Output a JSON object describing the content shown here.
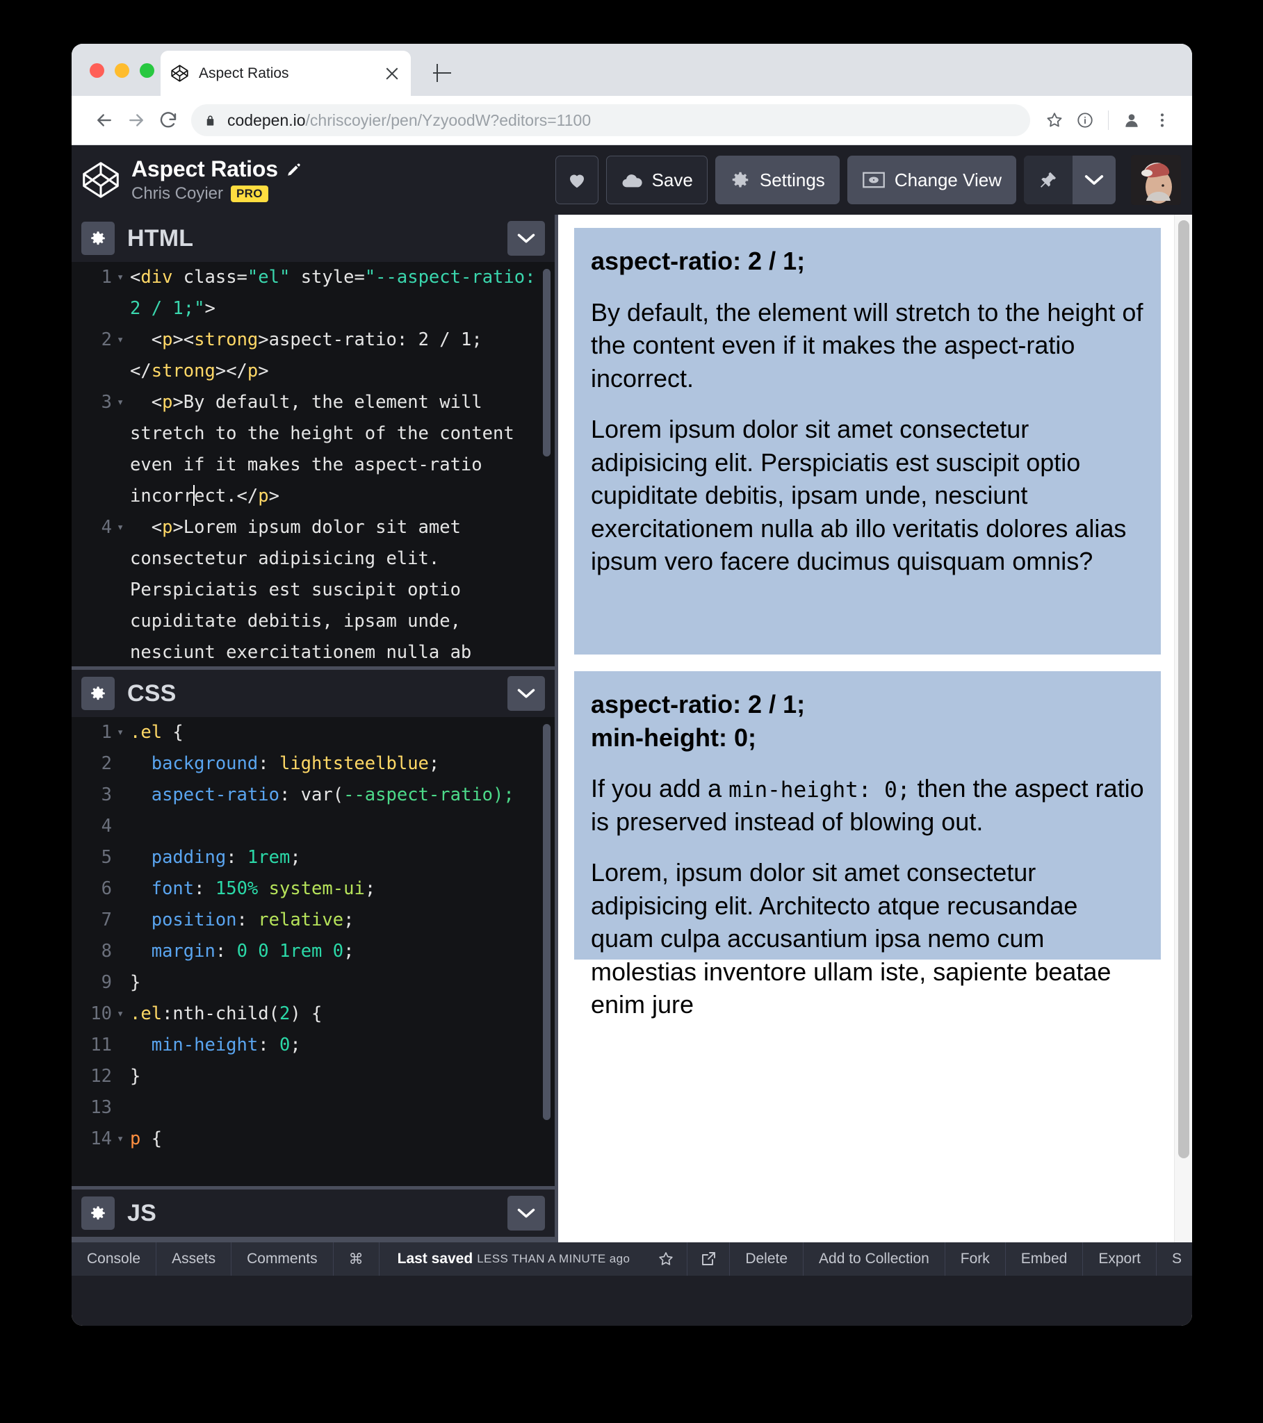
{
  "browser": {
    "tab": {
      "title": "Aspect Ratios",
      "favicon": "codepen-logo-icon",
      "close": "close-icon"
    },
    "new_tab": "new-tab-icon",
    "nav": {
      "back": "back-arrow-icon",
      "forward": "forward-arrow-icon",
      "reload": "reload-icon"
    },
    "omnibox": {
      "lock": "lock-icon",
      "host": "codepen.io",
      "path": "/chriscoyier/pen/YzyoodW?editors=1100",
      "full_url": "codepen.io/chriscoyier/pen/YzyoodW?editors=1100",
      "bookmark": "star-icon",
      "info": "info-circle-icon",
      "profile": "profile-avatar-icon",
      "menu": "three-dot-menu-icon"
    }
  },
  "pen_header": {
    "logo": "codepen-logo-icon",
    "title": "Aspect Ratios",
    "edit_icon": "pencil-icon",
    "author": "Chris Coyier",
    "pro_badge": "PRO",
    "buttons": {
      "heart": {
        "label": "",
        "icon": "heart-icon"
      },
      "save": {
        "label": "Save",
        "icon": "cloud-icon"
      },
      "settings": {
        "label": "Settings",
        "icon": "gear-icon"
      },
      "change_view": {
        "label": "Change View",
        "icon": "screen-eye-icon"
      },
      "pin": {
        "icon": "pin-icon"
      },
      "pin_caret": {
        "icon": "chevron-down-icon"
      }
    },
    "avatar": "user-avatar"
  },
  "editors": [
    {
      "id": "html",
      "label": "HTML",
      "gear": "gear-icon",
      "caret": "chevron-down-icon"
    },
    {
      "id": "css",
      "label": "CSS",
      "gear": "gear-icon",
      "caret": "chevron-down-icon"
    },
    {
      "id": "js",
      "label": "JS",
      "gear": "gear-icon",
      "caret": "chevron-down-icon"
    }
  ],
  "html_code": {
    "lines": [
      {
        "n": "1",
        "fold": true
      },
      {
        "n": "2",
        "fold": true
      },
      {
        "n": "3",
        "fold": true
      },
      {
        "n": "4",
        "fold": true
      }
    ],
    "source": [
      "<div class=\"el\" style=\"--aspect-ratio: 2 / 1;\">",
      "  <p><strong>aspect-ratio: 2 / 1;</strong></p>",
      "  <p>By default, the element will stretch to the height of the content even if it makes the aspect-ratio incorrect.</p>",
      "  <p>Lorem ipsum dolor sit amet consectetur adipisicing elit. Perspiciatis est suscipit optio cupiditate debitis, ipsam unde, nesciunt exercitationem nulla ab"
    ]
  },
  "css_code": {
    "lines": [
      {
        "n": "1",
        "fold": true,
        "text": ".el {"
      },
      {
        "n": "2",
        "fold": false,
        "text": "  background: lightsteelblue;"
      },
      {
        "n": "3",
        "fold": false,
        "text": "  aspect-ratio: var(--aspect-ratio);"
      },
      {
        "n": "4",
        "fold": false,
        "text": ""
      },
      {
        "n": "5",
        "fold": false,
        "text": "  padding: 1rem;"
      },
      {
        "n": "6",
        "fold": false,
        "text": "  font: 150% system-ui;"
      },
      {
        "n": "7",
        "fold": false,
        "text": "  position: relative;"
      },
      {
        "n": "8",
        "fold": false,
        "text": "  margin: 0 0 1rem 0;"
      },
      {
        "n": "9",
        "fold": false,
        "text": "}"
      },
      {
        "n": "10",
        "fold": true,
        "text": ".el:nth-child(2) {"
      },
      {
        "n": "11",
        "fold": false,
        "text": "  min-height: 0;"
      },
      {
        "n": "12",
        "fold": false,
        "text": "}"
      },
      {
        "n": "13",
        "fold": false,
        "text": ""
      },
      {
        "n": "14",
        "fold": true,
        "text": "p {"
      }
    ]
  },
  "preview": {
    "block1": {
      "heading": "aspect-ratio: 2 / 1;",
      "p1": "By default, the element will stretch to the height of the content even if it makes the aspect-ratio incorrect.",
      "p2": "Lorem ipsum dolor sit amet consectetur adipisicing elit. Perspiciatis est suscipit optio cupiditate debitis, ipsam unde, nesciunt exercitationem nulla ab illo veritatis dolores alias ipsum vero facere ducimus quisquam omnis?"
    },
    "block2": {
      "heading_line1": "aspect-ratio: 2 / 1;",
      "heading_line2": "min-height: 0;",
      "p1_before": "If you add a ",
      "p1_code": "min-height: 0;",
      "p1_after": " then the aspect ratio is preserved instead of blowing out.",
      "p2": "Lorem, ipsum dolor sit amet consectetur adipisicing elit. Architecto atque recusandae quam culpa accusantium ipsa nemo cum molestias inventore ullam iste, sapiente beatae enim jure"
    },
    "background_color": "#b0c4de"
  },
  "bottom_bar": {
    "console": "Console",
    "assets": "Assets",
    "comments": "Comments",
    "shortcut": "⌘",
    "saved_strong": "Last saved",
    "saved_rest": "LESS THAN A MINUTE ago",
    "star": "star-icon",
    "open_external": "external-link-icon",
    "delete": "Delete",
    "add_to_collection": "Add to Collection",
    "fork": "Fork",
    "embed": "Embed",
    "export": "Export",
    "share_truncated": "S"
  }
}
